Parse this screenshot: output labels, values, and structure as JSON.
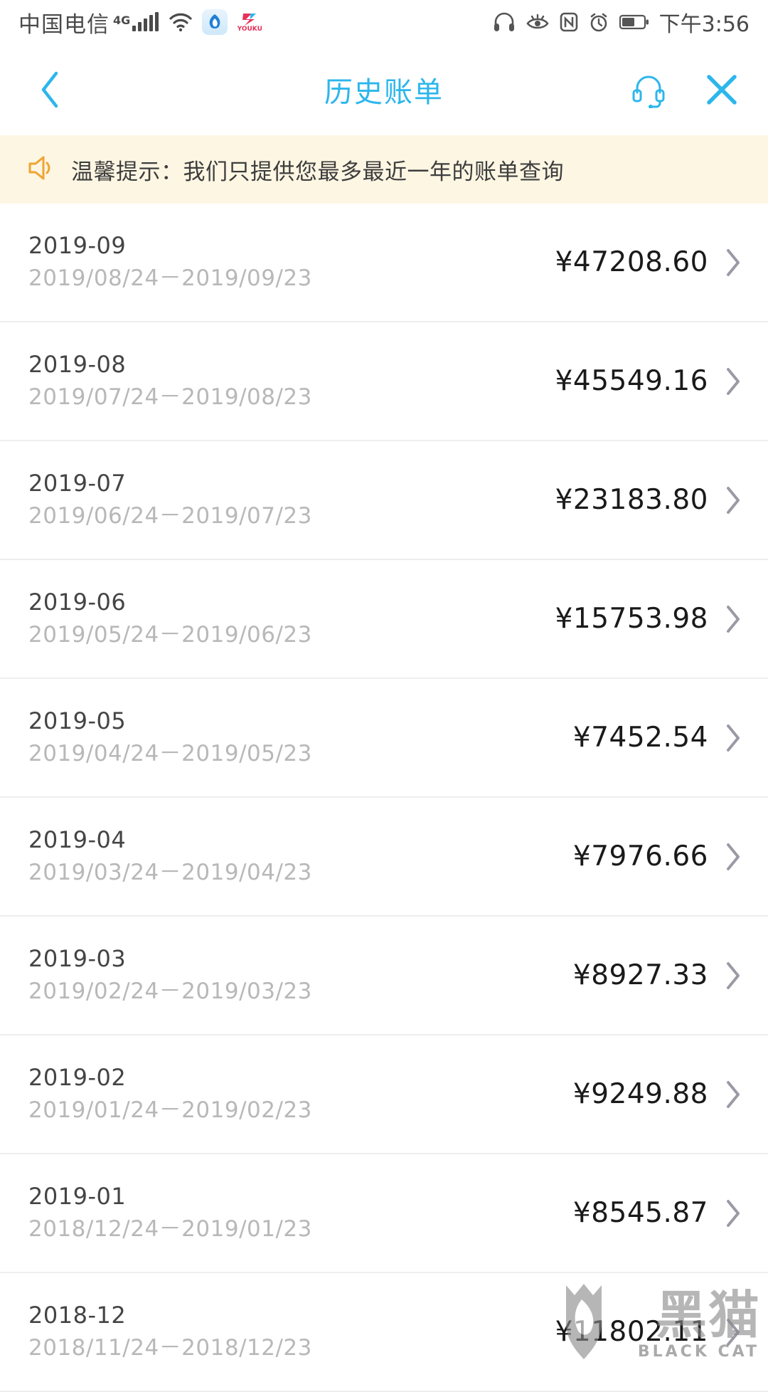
{
  "statusbar": {
    "carrier": "中国电信",
    "network": "4G",
    "time": "下午3:56",
    "icons": [
      "signal-bars-icon",
      "wifi-icon",
      "app-icon-blue",
      "app-icon-youku",
      "headphones-icon",
      "eye-comfort-icon",
      "nfc-icon",
      "alarm-icon",
      "battery-icon"
    ],
    "app_youku_label": "YOUKU"
  },
  "header": {
    "title": "历史账单",
    "back_icon": "chevron-left-icon",
    "service_icon": "headset-support-icon",
    "close_icon": "close-icon",
    "accent_color": "#2cb6ec"
  },
  "notice": {
    "icon": "speaker-icon",
    "icon_color": "#f0a431",
    "background_color": "#fdf6e3",
    "text": "温馨提示：我们只提供您最多最近一年的账单查询"
  },
  "bills": [
    {
      "month": "2019-09",
      "range": "2019/08/24－2019/09/23",
      "amount": "¥47208.60"
    },
    {
      "month": "2019-08",
      "range": "2019/07/24－2019/08/23",
      "amount": "¥45549.16"
    },
    {
      "month": "2019-07",
      "range": "2019/06/24－2019/07/23",
      "amount": "¥23183.80"
    },
    {
      "month": "2019-06",
      "range": "2019/05/24－2019/06/23",
      "amount": "¥15753.98"
    },
    {
      "month": "2019-05",
      "range": "2019/04/24－2019/05/23",
      "amount": "¥7452.54"
    },
    {
      "month": "2019-04",
      "range": "2019/03/24－2019/04/23",
      "amount": "¥7976.66"
    },
    {
      "month": "2019-03",
      "range": "2019/02/24－2019/03/23",
      "amount": "¥8927.33"
    },
    {
      "month": "2019-02",
      "range": "2019/01/24－2019/02/23",
      "amount": "¥9249.88"
    },
    {
      "month": "2019-01",
      "range": "2018/12/24－2019/01/23",
      "amount": "¥8545.87"
    },
    {
      "month": "2018-12",
      "range": "2018/11/24－2018/12/23",
      "amount": "¥11802.11"
    }
  ],
  "watermark": {
    "cn_text": "黑猫",
    "en_text": "BLACK CAT",
    "shield_icon": "black-cat-shield-icon"
  }
}
